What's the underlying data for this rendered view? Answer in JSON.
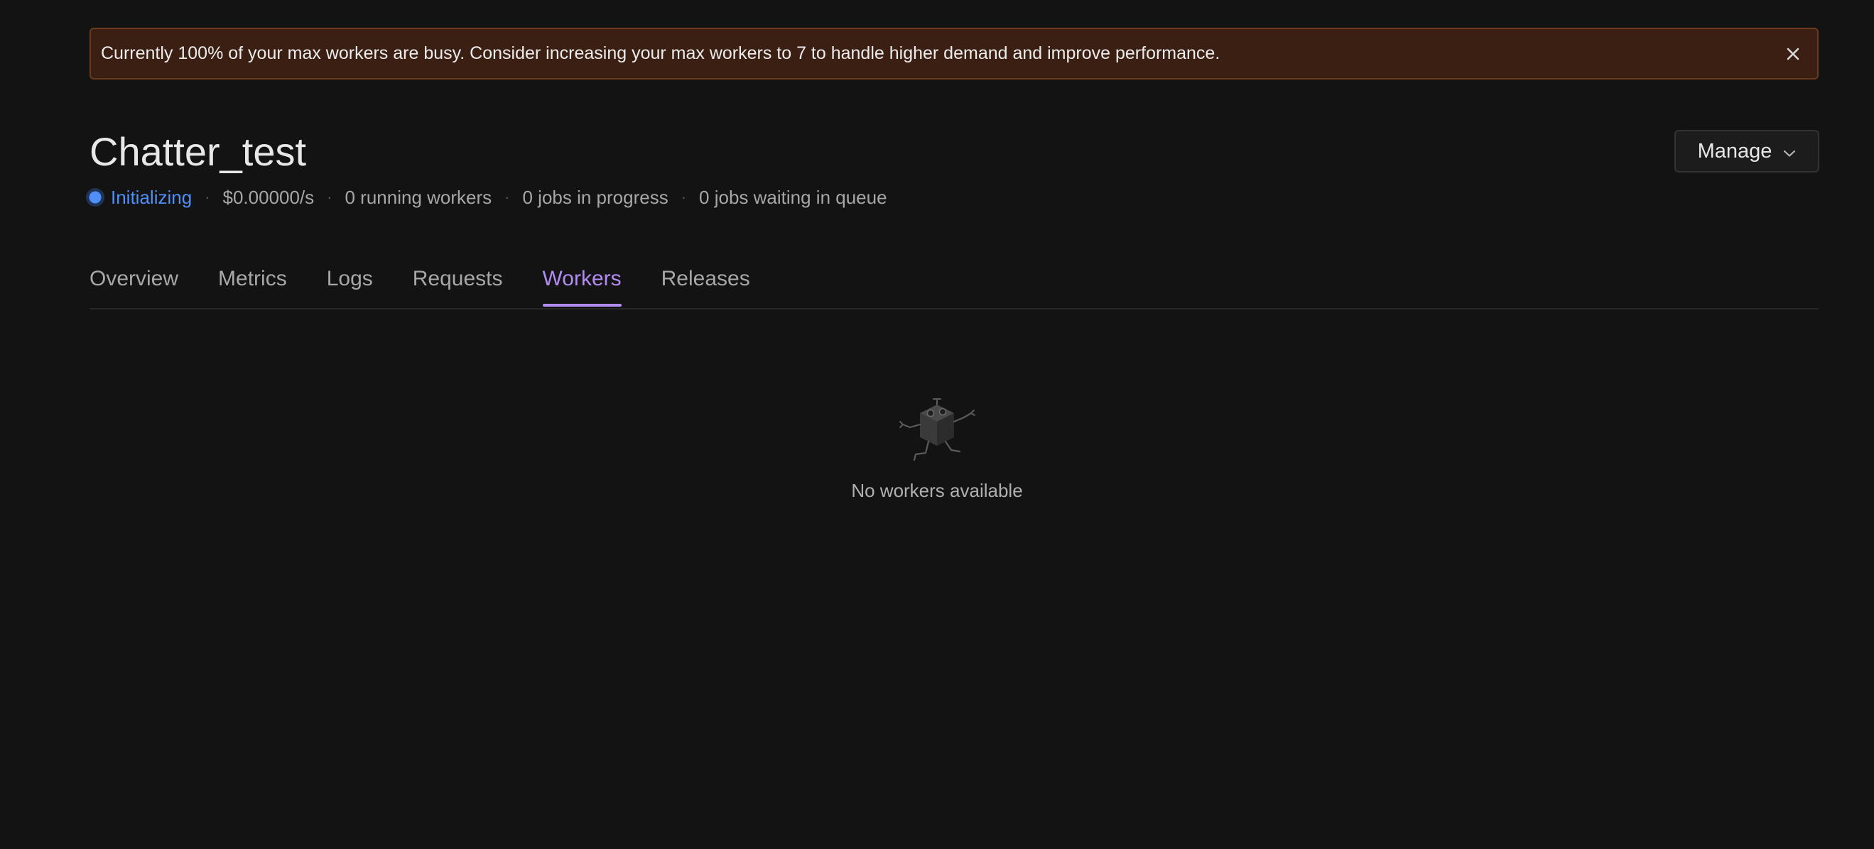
{
  "alert": {
    "message": "Currently 100% of your max workers are busy. Consider increasing your max workers to 7 to handle higher demand and improve performance.",
    "close_icon": "close-icon",
    "background_color": "#3b1f13",
    "border_color": "#6a3a1c"
  },
  "header": {
    "title": "Chatter_test",
    "manage_label": "Manage",
    "manage_icon": "chevron-down-icon"
  },
  "status": {
    "label": "Initializing",
    "color": "#4f8ff7",
    "cost": "$0.00000/s",
    "running_workers": "0 running workers",
    "jobs_in_progress": "0 jobs in progress",
    "jobs_waiting": "0 jobs waiting in queue"
  },
  "tabs": [
    {
      "label": "Overview",
      "active": false
    },
    {
      "label": "Metrics",
      "active": false
    },
    {
      "label": "Logs",
      "active": false
    },
    {
      "label": "Requests",
      "active": false
    },
    {
      "label": "Workers",
      "active": true
    },
    {
      "label": "Releases",
      "active": false
    }
  ],
  "accent_color": "#b38cf2",
  "empty_state": {
    "icon": "robot-cube-icon",
    "message": "No workers available"
  }
}
